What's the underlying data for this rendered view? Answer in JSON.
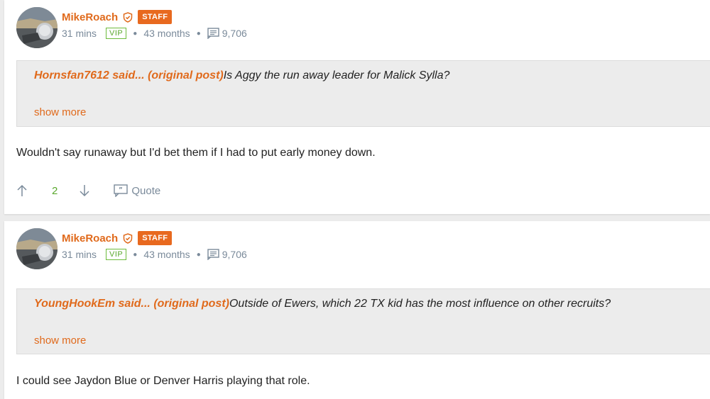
{
  "posts": [
    {
      "username": "MikeRoach",
      "badge": "STAFF",
      "time": "31 mins",
      "vip": "VIP",
      "tenure": "43 months",
      "post_count": "9,706",
      "quote": {
        "author": "Hornsfan7612",
        "said": " said...",
        "link": "original post",
        "text": "Is Aggy the run away leader for Malick Sylla?",
        "show_more": "show more"
      },
      "body": "Wouldn't say runaway but I'd bet them if I had to put early money down.",
      "votes": "2",
      "quote_label": "Quote"
    },
    {
      "username": "MikeRoach",
      "badge": "STAFF",
      "time": "31 mins",
      "vip": "VIP",
      "tenure": "43 months",
      "post_count": "9,706",
      "quote": {
        "author": "YoungHookEm",
        "said": " said...",
        "link": "original post",
        "text": "Outside of Ewers, which 22 TX kid has the most influence on other recruits?",
        "show_more": "show more"
      },
      "body": "I could see Jaydon Blue or Denver Harris playing that role."
    }
  ],
  "icons": {
    "shield": "shield-icon",
    "posts": "posts-icon",
    "upvote": "arrow-up-icon",
    "downvote": "arrow-down-icon",
    "quote": "quote-icon"
  },
  "colors": {
    "accent": "#e06a1c",
    "staff_badge": "#e8691f",
    "vip": "#5aa82e",
    "muted": "#7a8a9a",
    "quote_bg": "#ececec"
  }
}
